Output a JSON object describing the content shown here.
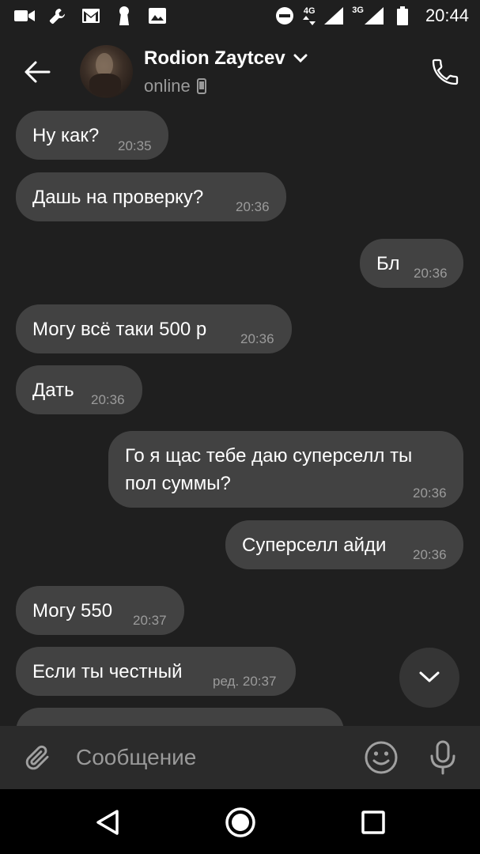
{
  "status_bar": {
    "time": "20:44",
    "net1": "4G",
    "net2": "3G",
    "icons": [
      "video-camera-icon",
      "wrench-icon",
      "gmail-icon",
      "keyhole-icon",
      "image-icon",
      "do-not-disturb-icon",
      "signal-icon",
      "battery-icon"
    ]
  },
  "header": {
    "name": "Rodion Zaytcev",
    "status": "online",
    "icons": [
      "back-arrow-icon",
      "chevron-down-icon",
      "phone-icon",
      "mobile-device-icon"
    ]
  },
  "messages": [
    {
      "direction": "in",
      "text": "Ну как?",
      "time": "20:35"
    },
    {
      "direction": "in",
      "text": "Дашь на проверку?",
      "time": "20:36"
    },
    {
      "direction": "out",
      "text": "Бл",
      "time": "20:36"
    },
    {
      "direction": "in",
      "text": "Могу всё таки 500 р",
      "time": "20:36"
    },
    {
      "direction": "in",
      "text": "Дать",
      "time": "20:36"
    },
    {
      "direction": "out",
      "lines": [
        "Го я щас тебе даю суперселл ты",
        "пол суммы?"
      ],
      "time": "20:36"
    },
    {
      "direction": "out",
      "text": "Суперселл айди",
      "time": "20:36"
    },
    {
      "direction": "in",
      "text": "Могу 550",
      "time": "20:37"
    },
    {
      "direction": "in",
      "text": "Если ты честный",
      "time": "ред. 20:37"
    }
  ],
  "composer": {
    "placeholder": "Сообщение",
    "icons": [
      "paperclip-icon",
      "emoji-icon",
      "microphone-icon"
    ]
  },
  "colors": {
    "background": "#1f1f1f",
    "bubble": "#424242",
    "timestamp": "#9b9b9b",
    "input_bar": "#2b2b2b"
  }
}
